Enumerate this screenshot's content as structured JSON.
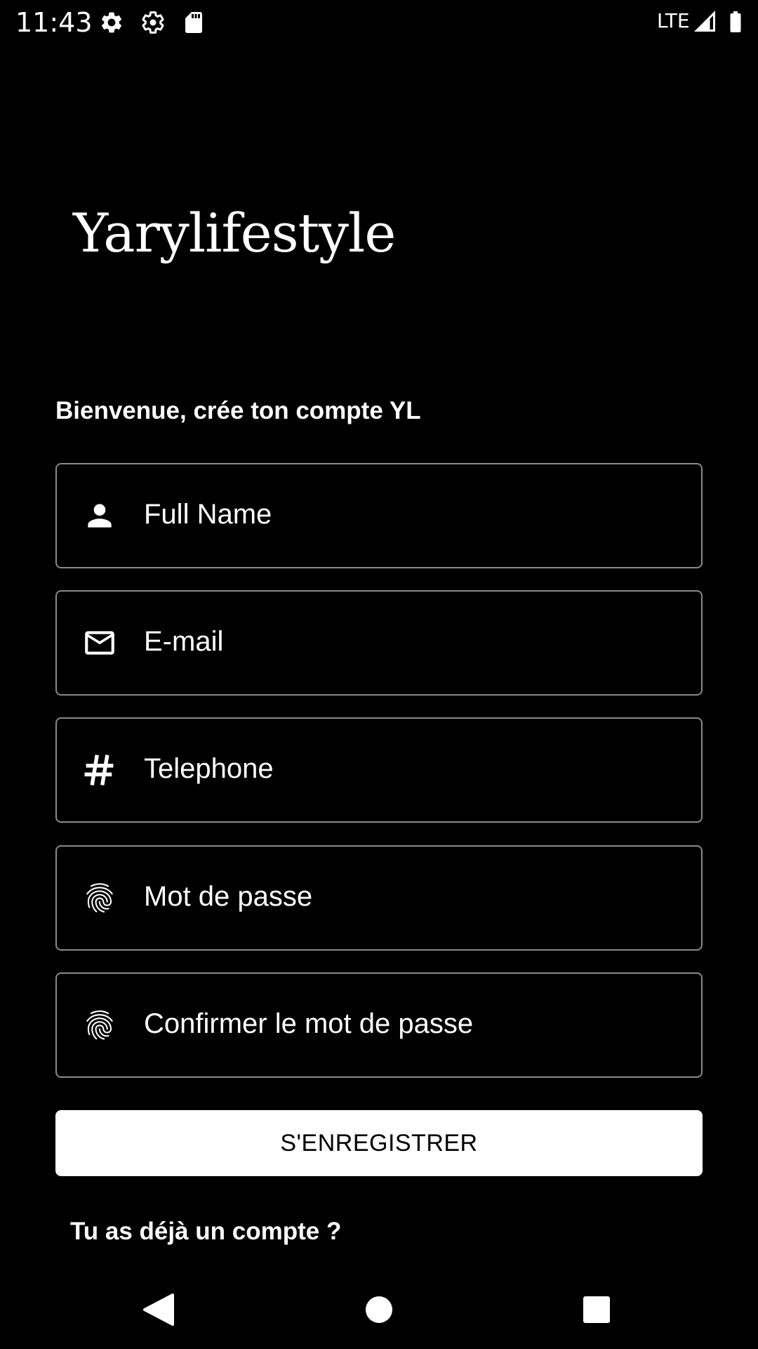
{
  "status_bar": {
    "time": "11:43",
    "icons": [
      "gear-icon",
      "gear-icon",
      "sd-card-icon"
    ],
    "network": "LTE",
    "signal_icon": "signal-icon",
    "battery_icon": "battery-icon"
  },
  "logo": {
    "text": "Yarylifestyle"
  },
  "form": {
    "welcome": "Bienvenue, crée ton compte YL",
    "fields": [
      {
        "icon": "person-icon",
        "placeholder": "Full Name",
        "value": ""
      },
      {
        "icon": "mail-icon",
        "placeholder": "E-mail",
        "value": ""
      },
      {
        "icon": "hash-icon",
        "placeholder": "Telephone",
        "value": ""
      },
      {
        "icon": "fingerprint-icon",
        "placeholder": "Mot de passe",
        "value": ""
      },
      {
        "icon": "fingerprint-icon",
        "placeholder": "Confirmer le mot de passe",
        "value": ""
      }
    ],
    "register_label": "S'ENREGISTRER",
    "login_prompt": "Tu as déjà un compte ?"
  },
  "nav_bar": {
    "back_icon": "back-triangle-icon",
    "home_icon": "home-circle-icon",
    "recents_icon": "recents-square-icon"
  },
  "colors": {
    "background": "#000000",
    "foreground": "#ffffff",
    "field_border": "#8a8a8a",
    "button_text": "#000000"
  }
}
